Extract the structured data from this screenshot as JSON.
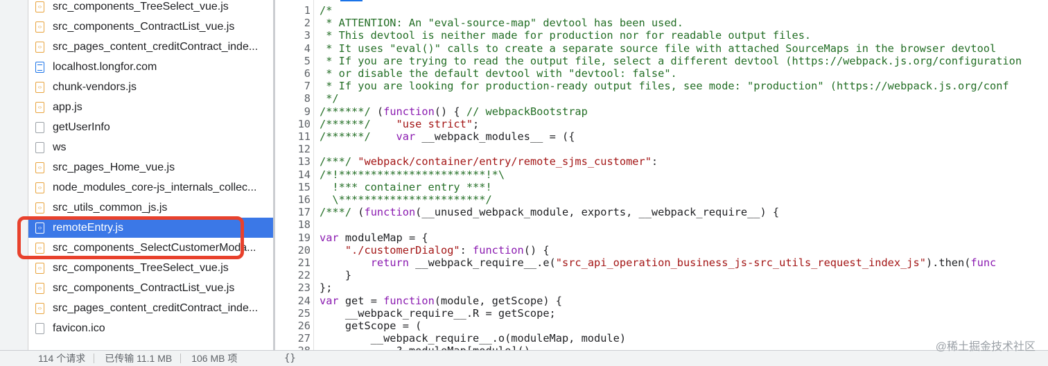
{
  "file_list": [
    {
      "name": "src_components_TreeSelect_vue.js",
      "icon": "js-file-icon"
    },
    {
      "name": "src_components_ContractList_vue.js",
      "icon": "js-file-icon"
    },
    {
      "name": "src_pages_content_creditContract_inde...",
      "icon": "js-file-icon"
    },
    {
      "name": "localhost.longfor.com",
      "icon": "document-icon"
    },
    {
      "name": "chunk-vendors.js",
      "icon": "js-file-icon"
    },
    {
      "name": "app.js",
      "icon": "js-file-icon"
    },
    {
      "name": "getUserInfo",
      "icon": "blank-file-icon"
    },
    {
      "name": "ws",
      "icon": "blank-file-icon"
    },
    {
      "name": "src_pages_Home_vue.js",
      "icon": "js-file-icon"
    },
    {
      "name": "node_modules_core-js_internals_collec...",
      "icon": "js-file-icon"
    },
    {
      "name": "src_utils_common_js.js",
      "icon": "js-file-icon"
    },
    {
      "name": "remoteEntry.js",
      "icon": "js-file-icon",
      "selected": true
    },
    {
      "name": "src_components_SelectCustomerModa...",
      "icon": "js-file-icon"
    },
    {
      "name": "src_components_TreeSelect_vue.js",
      "icon": "js-file-icon"
    },
    {
      "name": "src_components_ContractList_vue.js",
      "icon": "js-file-icon"
    },
    {
      "name": "src_pages_content_creditContract_inde...",
      "icon": "js-file-icon"
    },
    {
      "name": "favicon.ico",
      "icon": "blank-file-icon"
    }
  ],
  "code_lines": [
    {
      "n": "1",
      "segs": [
        {
          "t": "/*",
          "c": "cm"
        }
      ]
    },
    {
      "n": "2",
      "segs": [
        {
          "t": " * ATTENTION: An \"eval-source-map\" devtool has been used.",
          "c": "cm"
        }
      ]
    },
    {
      "n": "3",
      "segs": [
        {
          "t": " * This devtool is neither made for production nor for readable output files.",
          "c": "cm"
        }
      ]
    },
    {
      "n": "4",
      "segs": [
        {
          "t": " * It uses \"eval()\" calls to create a separate source file with attached SourceMaps in the browser devtool",
          "c": "cm"
        }
      ]
    },
    {
      "n": "5",
      "segs": [
        {
          "t": " * If you are trying to read the output file, select a different devtool (https://webpack.js.org/configuration",
          "c": "cm"
        }
      ]
    },
    {
      "n": "6",
      "segs": [
        {
          "t": " * or disable the default devtool with \"devtool: false\".",
          "c": "cm"
        }
      ]
    },
    {
      "n": "7",
      "segs": [
        {
          "t": " * If you are looking for production-ready output files, see mode: \"production\" (https://webpack.js.org/conf",
          "c": "cm"
        }
      ]
    },
    {
      "n": "8",
      "segs": [
        {
          "t": " */",
          "c": "cm"
        }
      ]
    },
    {
      "n": "9",
      "segs": [
        {
          "t": "/******/",
          "c": "cm"
        },
        {
          "t": " (",
          "c": ""
        },
        {
          "t": "function",
          "c": "kw"
        },
        {
          "t": "() { ",
          "c": ""
        },
        {
          "t": "// webpackBootstrap",
          "c": "cm"
        }
      ]
    },
    {
      "n": "10",
      "segs": [
        {
          "t": "/******/",
          "c": "cm"
        },
        {
          "t": "    ",
          "c": ""
        },
        {
          "t": "\"use strict\"",
          "c": "st"
        },
        {
          "t": ";",
          "c": ""
        }
      ]
    },
    {
      "n": "11",
      "segs": [
        {
          "t": "/******/",
          "c": "cm"
        },
        {
          "t": "    ",
          "c": ""
        },
        {
          "t": "var",
          "c": "kw"
        },
        {
          "t": " __webpack_modules__ = ({",
          "c": ""
        }
      ]
    },
    {
      "n": "12",
      "segs": [
        {
          "t": "",
          "c": ""
        }
      ]
    },
    {
      "n": "13",
      "segs": [
        {
          "t": "/***/",
          "c": "cm"
        },
        {
          "t": " ",
          "c": ""
        },
        {
          "t": "\"webpack/container/entry/remote_sjms_customer\"",
          "c": "st"
        },
        {
          "t": ":",
          "c": ""
        }
      ]
    },
    {
      "n": "14",
      "segs": [
        {
          "t": "/*!***********************!*\\",
          "c": "cm"
        }
      ]
    },
    {
      "n": "15",
      "segs": [
        {
          "t": "  !*** container entry ***!",
          "c": "cm"
        }
      ]
    },
    {
      "n": "16",
      "segs": [
        {
          "t": "  \\***********************/",
          "c": "cm"
        }
      ]
    },
    {
      "n": "17",
      "segs": [
        {
          "t": "/***/",
          "c": "cm"
        },
        {
          "t": " (",
          "c": ""
        },
        {
          "t": "function",
          "c": "kw"
        },
        {
          "t": "(__unused_webpack_module, exports, __webpack_require__) {",
          "c": ""
        }
      ]
    },
    {
      "n": "18",
      "segs": [
        {
          "t": "",
          "c": ""
        }
      ]
    },
    {
      "n": "19",
      "segs": [
        {
          "t": "var",
          "c": "kw"
        },
        {
          "t": " moduleMap = {",
          "c": ""
        }
      ]
    },
    {
      "n": "20",
      "segs": [
        {
          "t": "    ",
          "c": ""
        },
        {
          "t": "\"./customerDialog\"",
          "c": "st"
        },
        {
          "t": ": ",
          "c": ""
        },
        {
          "t": "function",
          "c": "kw"
        },
        {
          "t": "() {",
          "c": ""
        }
      ]
    },
    {
      "n": "21",
      "segs": [
        {
          "t": "        ",
          "c": ""
        },
        {
          "t": "return",
          "c": "kw"
        },
        {
          "t": " __webpack_require__.e(",
          "c": ""
        },
        {
          "t": "\"src_api_operation_business_js-src_utils_request_index_js\"",
          "c": "st"
        },
        {
          "t": ").then(",
          "c": ""
        },
        {
          "t": "func",
          "c": "kw"
        }
      ]
    },
    {
      "n": "22",
      "segs": [
        {
          "t": "    }",
          "c": ""
        }
      ]
    },
    {
      "n": "23",
      "segs": [
        {
          "t": "};",
          "c": ""
        }
      ]
    },
    {
      "n": "24",
      "segs": [
        {
          "t": "var",
          "c": "kw"
        },
        {
          "t": " get = ",
          "c": ""
        },
        {
          "t": "function",
          "c": "kw"
        },
        {
          "t": "(module, getScope) {",
          "c": ""
        }
      ]
    },
    {
      "n": "25",
      "segs": [
        {
          "t": "    __webpack_require__.R = getScope;",
          "c": ""
        }
      ]
    },
    {
      "n": "26",
      "segs": [
        {
          "t": "    getScope = (",
          "c": ""
        }
      ]
    },
    {
      "n": "27",
      "segs": [
        {
          "t": "        __webpack_require__.o(moduleMap, module)",
          "c": ""
        }
      ]
    },
    {
      "n": "28",
      "segs": [
        {
          "t": "            ? moduleMap[module]()",
          "c": ""
        }
      ]
    }
  ],
  "status": {
    "requests": "114 个请求",
    "transferred": "已传输 11.1 MB",
    "resources": "106 MB 项"
  },
  "bottom_toolbar": {
    "pretty_print": "{}"
  },
  "watermark": "@稀土掘金技术社区"
}
